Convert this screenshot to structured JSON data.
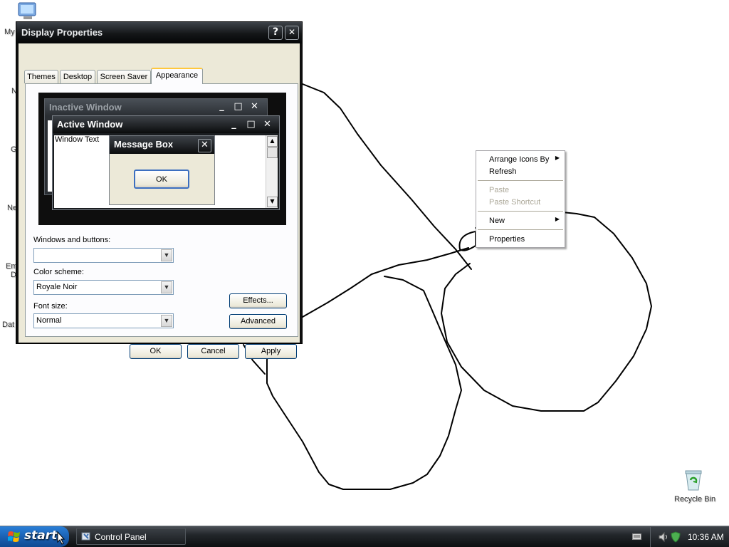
{
  "desktop": {
    "icons": [
      {
        "label": "My"
      },
      {
        "label": "N"
      },
      {
        "label": "G"
      },
      {
        "label": "Ne"
      },
      {
        "label": "Em"
      },
      {
        "label": "D"
      },
      {
        "label": "Dat"
      }
    ],
    "recycle_bin": {
      "label": "Recycle Bin",
      "icon": "recycle-bin-icon"
    }
  },
  "dialog": {
    "title": "Display Properties",
    "help_button": "?",
    "close_button": "✕",
    "tabs": [
      {
        "label": "Themes",
        "active": false
      },
      {
        "label": "Desktop",
        "active": false
      },
      {
        "label": "Screen Saver",
        "active": false
      },
      {
        "label": "Appearance",
        "active": true
      }
    ],
    "preview": {
      "inactive_title": "Inactive Window",
      "active_title": "Active Window",
      "window_text": "Window Text",
      "message_box_title": "Message Box",
      "ok_label": "OK"
    },
    "windows_and_buttons": {
      "label": "Windows and buttons:",
      "value": ""
    },
    "color_scheme": {
      "label": "Color scheme:",
      "value": "Royale Noir"
    },
    "font_size": {
      "label": "Font size:",
      "value": "Normal"
    },
    "effects_label": "Effects...",
    "advanced_label": "Advanced",
    "ok_label": "OK",
    "cancel_label": "Cancel",
    "apply_label": "Apply"
  },
  "context_menu": {
    "items": [
      {
        "label": "Arrange Icons By",
        "submenu": true,
        "enabled": true
      },
      {
        "label": "Refresh",
        "submenu": false,
        "enabled": true
      },
      {
        "label": "Paste",
        "submenu": false,
        "enabled": false
      },
      {
        "label": "Paste Shortcut",
        "submenu": false,
        "enabled": false
      },
      {
        "label": "New",
        "submenu": true,
        "enabled": true
      },
      {
        "label": "Properties",
        "submenu": false,
        "enabled": true
      }
    ]
  },
  "taskbar": {
    "start_label": "start",
    "tasks": [
      {
        "label": "Control Panel",
        "icon": "control-panel-icon"
      }
    ],
    "clock": "10:36 AM"
  },
  "colors": {
    "title_bar": "#141618",
    "dialog_face": "#ece9d8",
    "tab_highlight": "#ffc83c",
    "start_button": "#1a5fb0",
    "taskbar": "#23272b"
  }
}
